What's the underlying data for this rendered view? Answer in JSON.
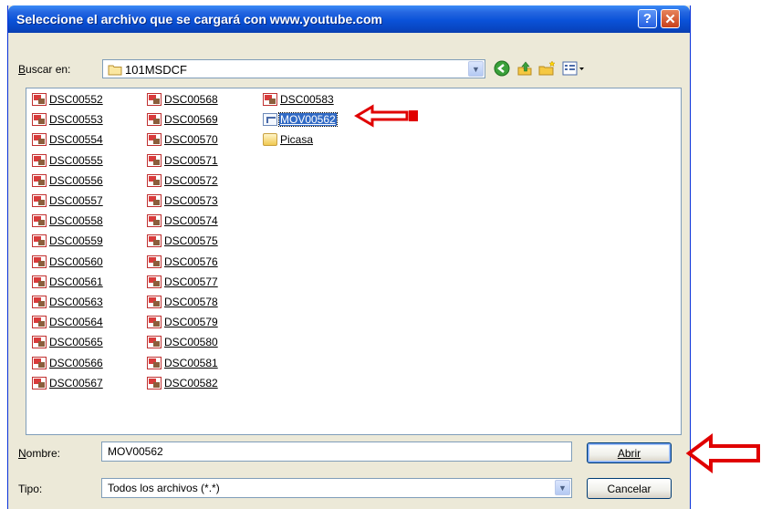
{
  "dialog": {
    "title": "Seleccione el archivo que se cargará con www.youtube.com",
    "help_label": "?",
    "close_label": "✕"
  },
  "toolbar": {
    "look_in_label": "Buscar en:",
    "look_in_value": "101MSDCF",
    "icons": [
      "back-icon",
      "up-folder-icon",
      "new-folder-icon",
      "view-menu-icon"
    ]
  },
  "files": {
    "col1": [
      "DSC00552",
      "DSC00553",
      "DSC00554",
      "DSC00555",
      "DSC00556",
      "DSC00557",
      "DSC00558",
      "DSC00559",
      "DSC00560",
      "DSC00561",
      "DSC00563",
      "DSC00564",
      "DSC00565",
      "DSC00566",
      "DSC00567"
    ],
    "col2": [
      "DSC00568",
      "DSC00569",
      "DSC00570",
      "DSC00571",
      "DSC00572",
      "DSC00573",
      "DSC00574",
      "DSC00575",
      "DSC00576",
      "DSC00577",
      "DSC00578",
      "DSC00579",
      "DSC00580",
      "DSC00581",
      "DSC00582"
    ],
    "col3": [
      "DSC00583",
      "MOV00562",
      "Picasa"
    ],
    "selected": "MOV00562"
  },
  "form": {
    "name_label": "Nombre:",
    "name_value": "MOV00562",
    "type_label": "Tipo:",
    "type_value": "Todos los archivos (*.*)",
    "open_label": "Abrir",
    "cancel_label": "Cancelar"
  },
  "colors": {
    "title_bar": "#0a52d8",
    "selection": "#316ac5",
    "annotation_arrow": "#e00000"
  }
}
